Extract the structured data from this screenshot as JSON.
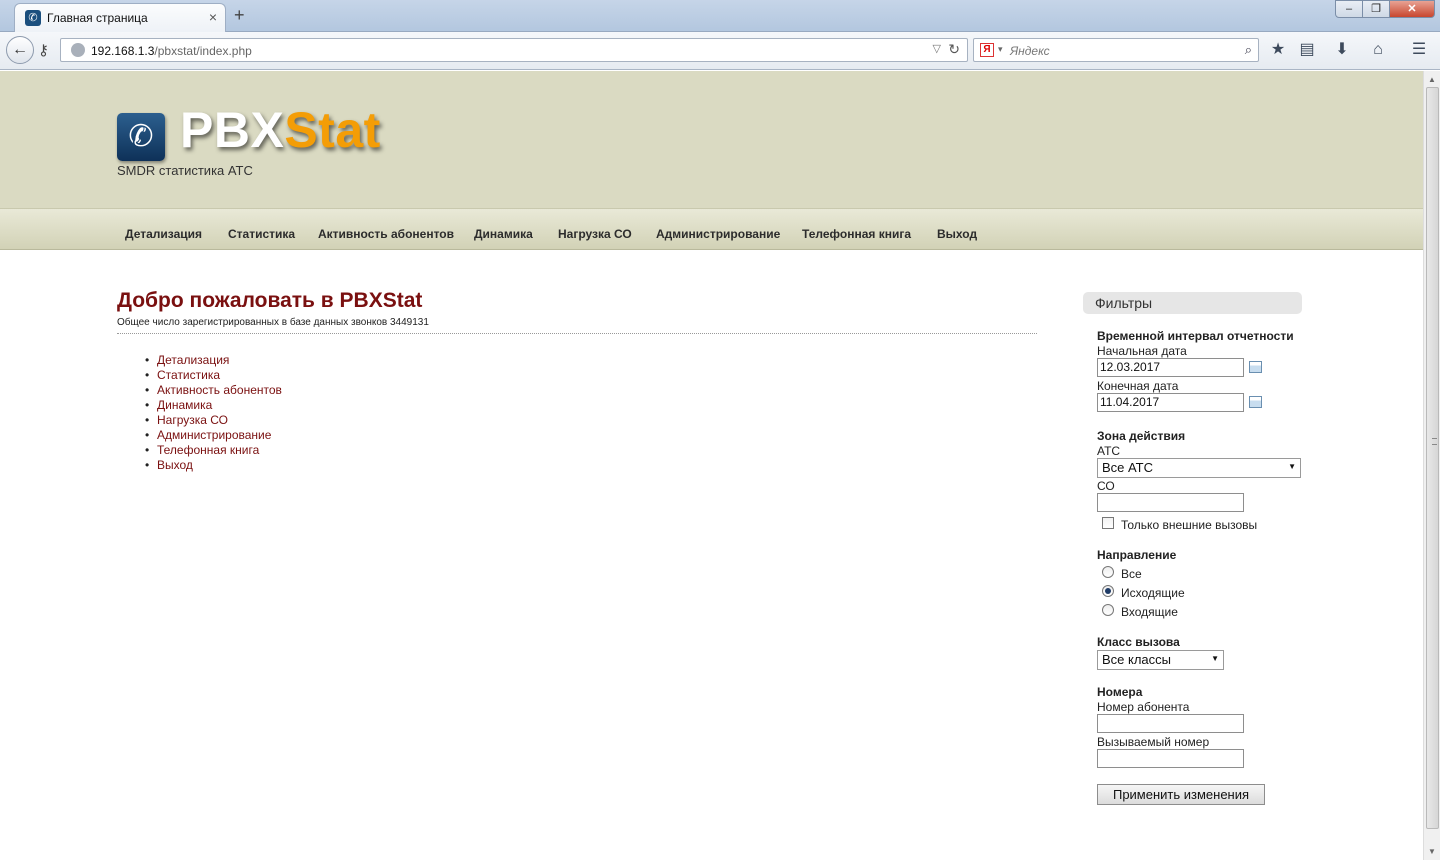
{
  "browser": {
    "tab_title": "Главная страница",
    "new_tab": "+",
    "close_tab": "×",
    "url_host": "192.168.1.3",
    "url_path": "/pbxstat/index.php",
    "search_placeholder": "Яндекс",
    "search_engine": "Я",
    "window_controls": {
      "minimize": "–",
      "maximize": "❐",
      "close": "✕"
    },
    "icons": [
      "back-icon",
      "key-icon",
      "reload-icon",
      "search-icon",
      "bookmark-star-icon",
      "reading-list-icon",
      "download-icon",
      "home-icon",
      "menu-icon"
    ]
  },
  "site": {
    "logo_pbx": "PBX",
    "logo_stat": "Stat",
    "subtitle": "SMDR статистика АТС",
    "colors": {
      "header_bg": "#dadac2",
      "logo_accent": "#f49d06",
      "link": "#7a1010",
      "logo_box": "#1b4f7e"
    }
  },
  "menu": [
    "Детализация",
    "Статистика",
    "Активность абонентов",
    "Динамика",
    "Нагрузка СО",
    "Администрирование",
    "Телефонная книга",
    "Выход"
  ],
  "main": {
    "heading": "Добро пожаловать в PBXStat",
    "count_text": "Общее число зарегистрированных в базе данных звонков 3449131",
    "links": [
      "Детализация",
      "Статистика",
      "Активность абонентов",
      "Динамика",
      "Нагрузка СО",
      "Администрирование",
      "Телефонная книга",
      "Выход"
    ]
  },
  "filters": {
    "title": "Фильтры",
    "period": {
      "heading": "Временной интервал отчетности",
      "start_label": "Начальная дата",
      "start_value": "12.03.2017",
      "end_label": "Конечная дата",
      "end_value": "11.04.2017"
    },
    "zone": {
      "heading": "Зона действия",
      "pbx_label": "АТС",
      "pbx_value": "Все АТС",
      "co_label": "СО",
      "co_value": "",
      "external_only": "Только внешние вызовы"
    },
    "direction": {
      "heading": "Направление",
      "options": [
        "Все",
        "Исходящие",
        "Входящие"
      ],
      "selected": "Исходящие"
    },
    "call_class": {
      "heading": "Класс вызова",
      "value": "Все классы"
    },
    "numbers": {
      "heading": "Номера",
      "subscriber_label": "Номер абонента",
      "subscriber_value": "",
      "called_label": "Вызываемый номер",
      "called_value": ""
    },
    "apply": "Применить изменения"
  }
}
